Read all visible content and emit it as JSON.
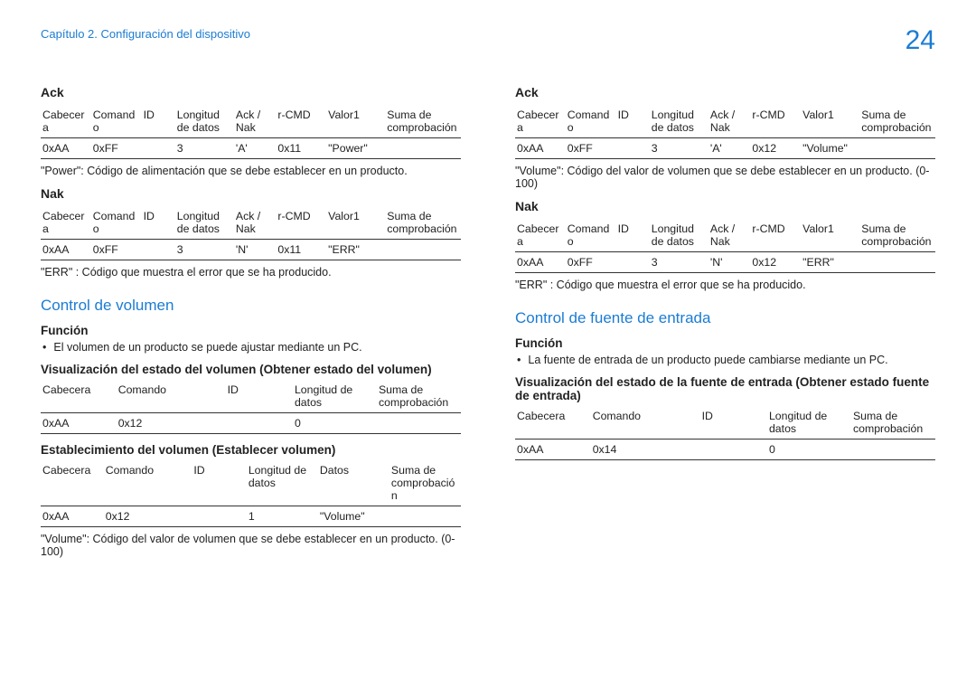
{
  "header": {
    "chapter": "Capítulo 2. Configuración del dispositivo",
    "page": "24"
  },
  "left": {
    "ack": {
      "title": "Ack",
      "headers": [
        "Cabecera",
        "Comando",
        "ID",
        "Longitud de datos",
        "Ack / Nak",
        "r-CMD",
        "Valor1",
        "Suma de comprobación"
      ],
      "row": [
        "0xAA",
        "0xFF",
        "",
        "3",
        "'A'",
        "0x11",
        "\"Power\"",
        ""
      ],
      "note": "\"Power\": Código de alimentación que se debe establecer en un producto."
    },
    "nak": {
      "title": "Nak",
      "headers": [
        "Cabecera",
        "Comando",
        "ID",
        "Longitud de datos",
        "Ack / Nak",
        "r-CMD",
        "Valor1",
        "Suma de comprobación"
      ],
      "row": [
        "0xAA",
        "0xFF",
        "",
        "3",
        "'N'",
        "0x11",
        "\"ERR\"",
        ""
      ],
      "note": "\"ERR\" : Código que muestra el error que se ha producido."
    },
    "section_title": "Control de volumen",
    "funcion_title": "Función",
    "funcion_bullet": "El volumen de un producto se puede ajustar mediante un PC.",
    "vis_title": "Visualización del estado del volumen (Obtener estado del volumen)",
    "vis": {
      "headers": [
        "Cabecera",
        "Comando",
        "ID",
        "Longitud de datos",
        "Suma de comprobación"
      ],
      "row": [
        "0xAA",
        "0x12",
        "",
        "0",
        ""
      ]
    },
    "set_title": "Establecimiento del volumen (Establecer volumen)",
    "set": {
      "headers": [
        "Cabecera",
        "Comando",
        "ID",
        "Longitud de datos",
        "Datos",
        "Suma de comprobación"
      ],
      "row": [
        "0xAA",
        "0x12",
        "",
        "1",
        "\"Volume\"",
        ""
      ]
    },
    "vol_note": "\"Volume\": Código del valor de volumen que se debe establecer en un producto. (0-100)"
  },
  "right": {
    "ack": {
      "title": "Ack",
      "headers": [
        "Cabecera",
        "Comando",
        "ID",
        "Longitud de datos",
        "Ack / Nak",
        "r-CMD",
        "Valor1",
        "Suma de comprobación"
      ],
      "row": [
        "0xAA",
        "0xFF",
        "",
        "3",
        "'A'",
        "0x12",
        "\"Volume\"",
        ""
      ],
      "note": "\"Volume\": Código del valor de volumen que se debe establecer en un producto. (0-100)"
    },
    "nak": {
      "title": "Nak",
      "headers": [
        "Cabecera",
        "Comando",
        "ID",
        "Longitud de datos",
        "Ack / Nak",
        "r-CMD",
        "Valor1",
        "Suma de comprobación"
      ],
      "row": [
        "0xAA",
        "0xFF",
        "",
        "3",
        "'N'",
        "0x12",
        "\"ERR\"",
        ""
      ],
      "note": "\"ERR\" : Código que muestra el error que se ha producido."
    },
    "section_title": "Control de fuente de entrada",
    "funcion_title": "Función",
    "funcion_bullet": "La fuente de entrada de un producto puede cambiarse mediante un PC.",
    "vis_title": "Visualización del estado de la fuente de entrada (Obtener estado fuente de entrada)",
    "vis": {
      "headers": [
        "Cabecera",
        "Comando",
        "ID",
        "Longitud de datos",
        "Suma de comprobación"
      ],
      "row": [
        "0xAA",
        "0x14",
        "",
        "0",
        ""
      ]
    }
  }
}
